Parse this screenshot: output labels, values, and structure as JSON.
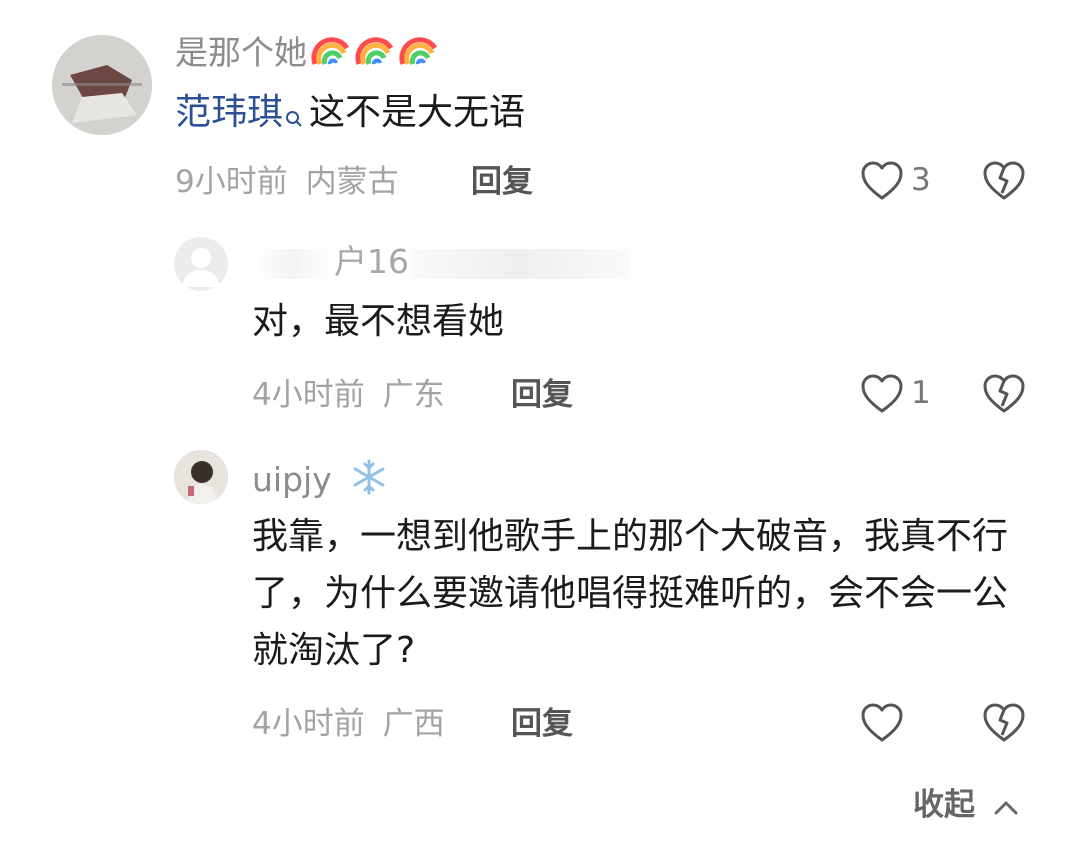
{
  "comment1": {
    "username": "是那个她",
    "badge_icons": [
      "rainbow-icon",
      "rainbow-icon",
      "rainbow-icon"
    ],
    "mention": "范玮琪",
    "text": "这不是大无语",
    "time": "9小时前",
    "location": "内蒙古",
    "reply_label": "回复",
    "like_count": "3"
  },
  "reply1": {
    "username_visible": "户16",
    "text": "对，最不想看她",
    "time": "4小时前",
    "location": "广东",
    "reply_label": "回复",
    "like_count": "1"
  },
  "reply2": {
    "username": "uipjy",
    "badge_icon": "snowflake-icon",
    "text": "我靠，一想到他歌手上的那个大破音，我真不行了，为什么要邀请他唱得挺难听的，会不会一公就淘汰了?",
    "time": "4小时前",
    "location": "广西",
    "reply_label": "回复"
  },
  "footer": {
    "collapse_label": "收起"
  },
  "colors": {
    "mention": "#2d4f94",
    "meta": "#a3a3a3",
    "icon": "#555555"
  }
}
